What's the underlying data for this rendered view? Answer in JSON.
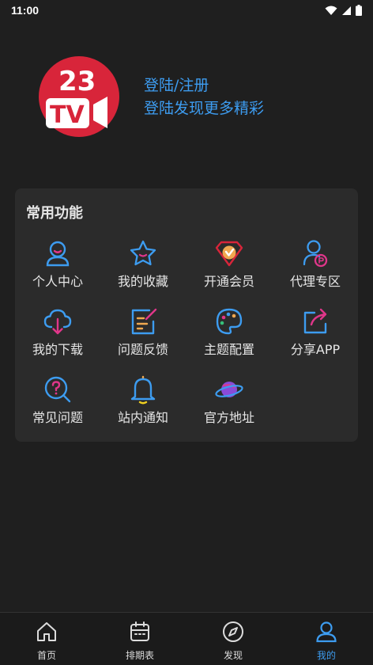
{
  "status_bar": {
    "time": "11:00",
    "icons": [
      "wifi-icon",
      "signal-icon",
      "battery-icon"
    ]
  },
  "header": {
    "logo_text_top": "23",
    "logo_text_bottom": "TV",
    "login_label": "登陆/注册",
    "login_subtitle": "登陆发现更多精彩"
  },
  "functions": {
    "title": "常用功能",
    "items": [
      {
        "label": "个人中心",
        "icon": "user-icon"
      },
      {
        "label": "我的收藏",
        "icon": "star-icon"
      },
      {
        "label": "开通会员",
        "icon": "vip-icon"
      },
      {
        "label": "代理专区",
        "icon": "agent-icon"
      },
      {
        "label": "我的下载",
        "icon": "cloud-download-icon"
      },
      {
        "label": "问题反馈",
        "icon": "feedback-icon"
      },
      {
        "label": "主题配置",
        "icon": "palette-icon"
      },
      {
        "label": "分享APP",
        "icon": "share-icon"
      },
      {
        "label": "常见问题",
        "icon": "help-icon"
      },
      {
        "label": "站内通知",
        "icon": "bell-icon"
      },
      {
        "label": "官方地址",
        "icon": "planet-icon"
      }
    ]
  },
  "tabbar": {
    "tabs": [
      {
        "label": "首页",
        "icon": "home-icon",
        "active": false
      },
      {
        "label": "排期表",
        "icon": "calendar-icon",
        "active": false
      },
      {
        "label": "发现",
        "icon": "compass-icon",
        "active": false
      },
      {
        "label": "我的",
        "icon": "profile-icon",
        "active": true
      }
    ]
  },
  "colors": {
    "accent": "#3d9cf0",
    "background": "#1f1f1f",
    "card": "#2b2b2b",
    "logo_red": "#d8253a"
  }
}
